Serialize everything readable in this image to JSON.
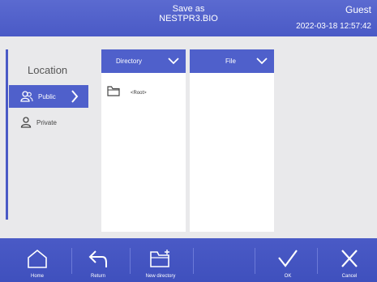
{
  "header": {
    "title_line1": "Save as",
    "title_line2": "NESTPR3.BIO",
    "user": "Guest",
    "datetime": "2022-03-18 12:57:42"
  },
  "location": {
    "title": "Location",
    "items": [
      {
        "label": "Public",
        "icon": "group-icon",
        "selected": true
      },
      {
        "label": "Private",
        "icon": "person-icon",
        "selected": false
      }
    ]
  },
  "directory_panel": {
    "header": "Directory",
    "items": [
      {
        "label": "<Root>",
        "icon": "folder-icon"
      }
    ]
  },
  "file_panel": {
    "header": "File"
  },
  "footer": {
    "home": "Home",
    "return": "Return",
    "new_directory": "New directory",
    "ok": "OK",
    "cancel": "Cancel"
  },
  "colors": {
    "accent": "#4f60cb",
    "header": "#4a5ac6",
    "background": "#e9e9eb"
  }
}
